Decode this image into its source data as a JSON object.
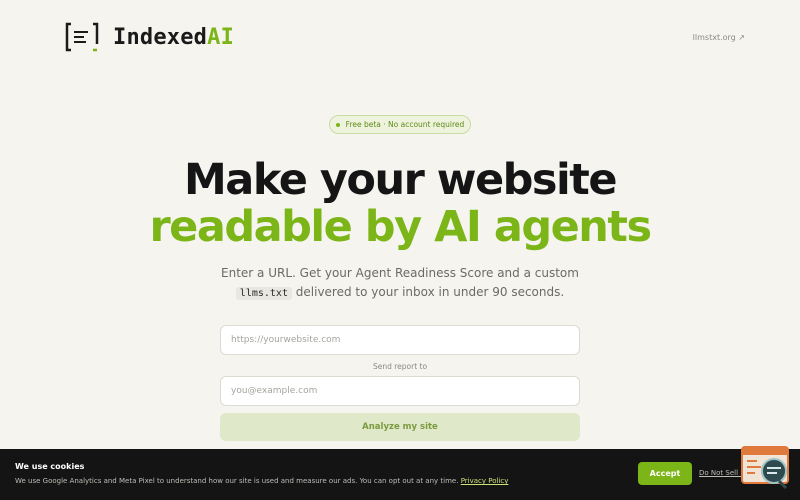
{
  "header": {
    "logo_text_main": "Indexed",
    "logo_text_accent": "AI",
    "top_link": "llmstxt.org ↗"
  },
  "hero": {
    "badge": "Free beta · No account required",
    "headline_line1": "Make your website",
    "headline_line2": "readable by AI agents",
    "subtitle_line1": "Enter a URL. Get your Agent Readiness Score and a custom",
    "subtitle_code": "llms.txt",
    "subtitle_line2_rest": " delivered to your inbox in under 90 seconds."
  },
  "form": {
    "url_placeholder": "https://yourwebsite.com",
    "url_value": "",
    "send_label": "Send report to",
    "email_placeholder": "you@example.com",
    "email_value": "",
    "analyze_label": "Analyze my site"
  },
  "cookie_bar": {
    "title": "We use cookies",
    "text": "We use Google Analytics and Meta Pixel to understand how our site is used and measure our ads. You can opt out at any time.",
    "policy_link": "Privacy Policy",
    "accept_label": "Accept",
    "do_not_sell_label": "Do Not Sell My Info"
  },
  "colors": {
    "accent": "#7cb518",
    "background": "#f5f4ef",
    "cookie_bg": "#141414",
    "widget": "#e07a3c"
  },
  "icons": {
    "logo": "bracket-document-icon",
    "badge": "status-dot-icon",
    "widget": "chat-support-icon"
  }
}
